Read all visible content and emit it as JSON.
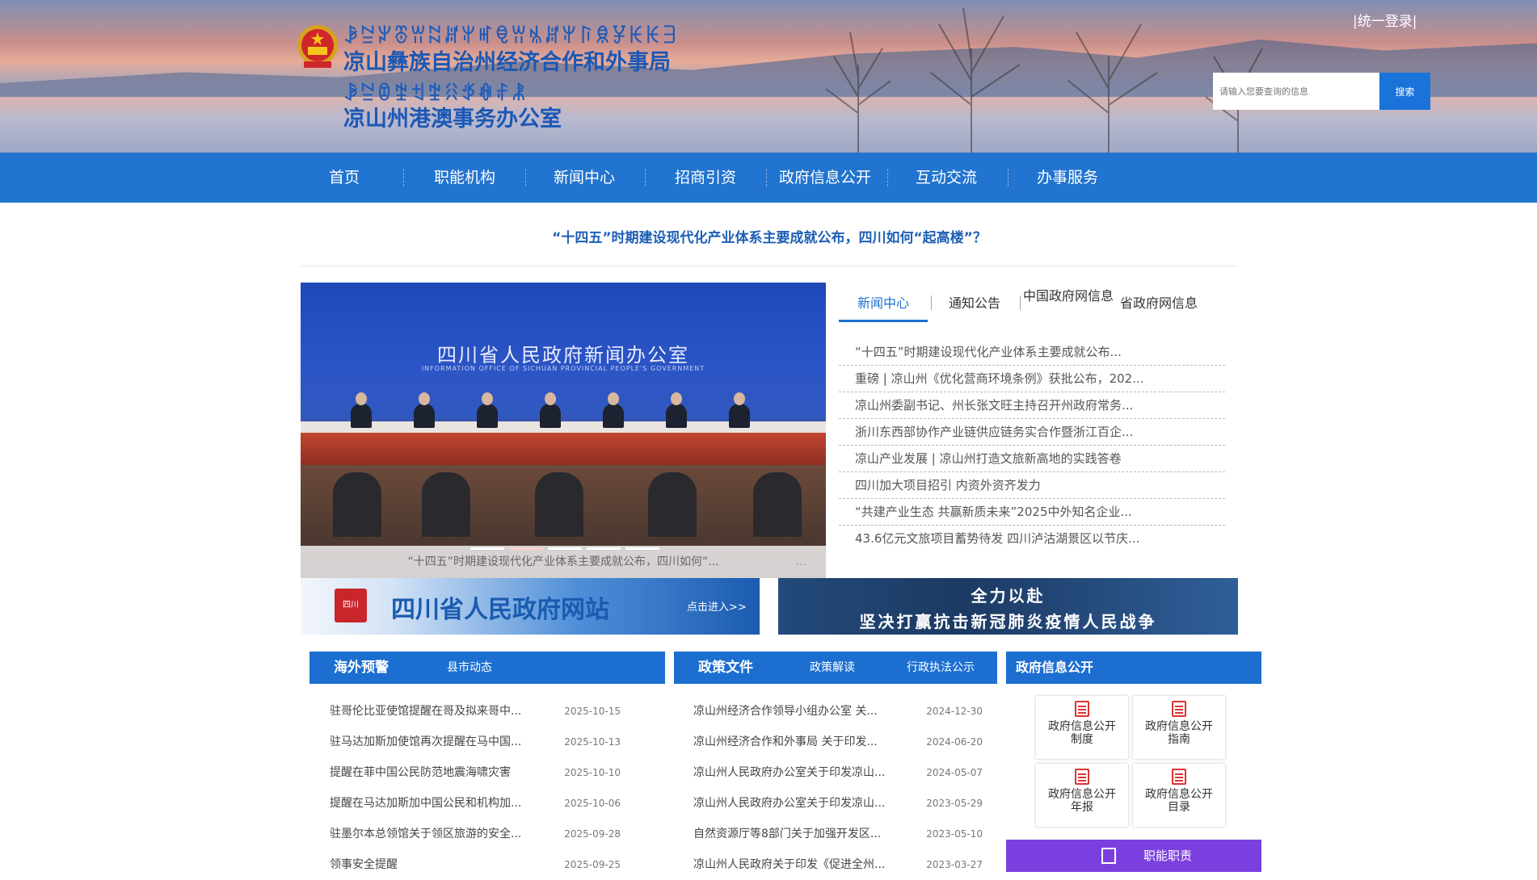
{
  "header": {
    "yi_title_1": "ꆃꊂꏃꁨꀕꉆꏦꅍꎭꋠꀕꁱꏦꅍꑍꌋꐯꀘꀘꎆ",
    "cn_title_1": "凉山彝族自治州经济合作和外事局",
    "yi_title_2": "ꆃꊂꀧꄹꉬꄹꋧꉪꊿꄙꂿ",
    "cn_title_2": "凉山州港澳事务办公室",
    "login": "|统一登录|",
    "search_placeholder": "请输入您要查询的信息",
    "search_button": "搜索"
  },
  "nav": {
    "items": [
      "首页",
      "职能机构",
      "新闻中心",
      "招商引资",
      "政府信息公开",
      "互动交流",
      "办事服务"
    ]
  },
  "headline": "“十四五”时期建设现代化产业体系主要成就公布，四川如何“起高楼”？",
  "carousel": {
    "banner_title": "四川省人民政府新闻办公室",
    "banner_subtitle": "INFORMATION OFFICE OF SICHUAN PROVINCIAL PEOPLE'S GOVERNMENT",
    "caption": "“十四五”时期建设现代化产业体系主要成就公布，四川如何“...",
    "caption_more": "...",
    "active_slide": 2,
    "slide_count": 5
  },
  "news_tabs": {
    "tabs": [
      "新闻中心",
      "通知公告",
      "中国政府网信息",
      "省政府网信息"
    ],
    "items": [
      "“十四五”时期建设现代化产业体系主要成就公布...",
      "重磅 | 凉山州《优化营商环境条例》获批公布，202...",
      "凉山州委副书记、州长张文旺主持召开州政府常务...",
      "浙川东西部协作产业链供应链务实合作暨浙江百企...",
      "凉山产业发展 | 凉山州打造文旅新高地的实践答卷",
      "四川加大项目招引 内资外资齐发力",
      "“共建产业生态 共赢新质未来”2025中外知名企业...",
      "43.6亿元文旅项目蓄势待发 四川泸沽湖景区以节庆..."
    ]
  },
  "banners": {
    "left_seal": "四川",
    "left_title": "四川省人民政府网站",
    "left_enter": "点击进入>>",
    "right_line1": "全力以赴",
    "right_line2": "坚决打赢抗击新冠肺炎疫情人民战争"
  },
  "panel_overseas": {
    "title": "海外预警",
    "sub": "县市动态",
    "rows": [
      {
        "text": "驻哥伦比亚使馆提醒在哥及拟来哥中...",
        "date": "2025-10-15"
      },
      {
        "text": "驻马达加斯加使馆再次提醒在马中国...",
        "date": "2025-10-13"
      },
      {
        "text": "提醒在菲中国公民防范地震海啸灾害",
        "date": "2025-10-10"
      },
      {
        "text": "提醒在马达加斯加中国公民和机构加...",
        "date": "2025-10-06"
      },
      {
        "text": "驻墨尔本总领馆关于领区旅游的安全...",
        "date": "2025-09-28"
      },
      {
        "text": "领事安全提醒",
        "date": "2025-09-25"
      }
    ]
  },
  "panel_policy": {
    "title": "政策文件",
    "sub1": "政策解读",
    "sub2": "行政执法公示",
    "rows": [
      {
        "text": "凉山州经济合作领导小组办公室 关...",
        "date": "2024-12-30"
      },
      {
        "text": "凉山州经济合作和外事局 关于印发...",
        "date": "2024-06-20"
      },
      {
        "text": "凉山州人民政府办公室关于印发凉山...",
        "date": "2024-05-07"
      },
      {
        "text": "凉山州人民政府办公室关于印发凉山...",
        "date": "2023-05-29"
      },
      {
        "text": "自然资源厅等8部门关于加强开发区...",
        "date": "2023-05-10"
      },
      {
        "text": "凉山州人民政府关于印发《促进全州...",
        "date": "2023-03-27"
      }
    ]
  },
  "panel_gov": {
    "title": "政府信息公开",
    "cards": [
      {
        "line1": "政府信息公开",
        "line2": "制度"
      },
      {
        "line1": "政府信息公开",
        "line2": "指南"
      },
      {
        "line1": "政府信息公开",
        "line2": "年报"
      },
      {
        "line1": "政府信息公开",
        "line2": "目录"
      }
    ],
    "duty_button": "职能职责"
  }
}
